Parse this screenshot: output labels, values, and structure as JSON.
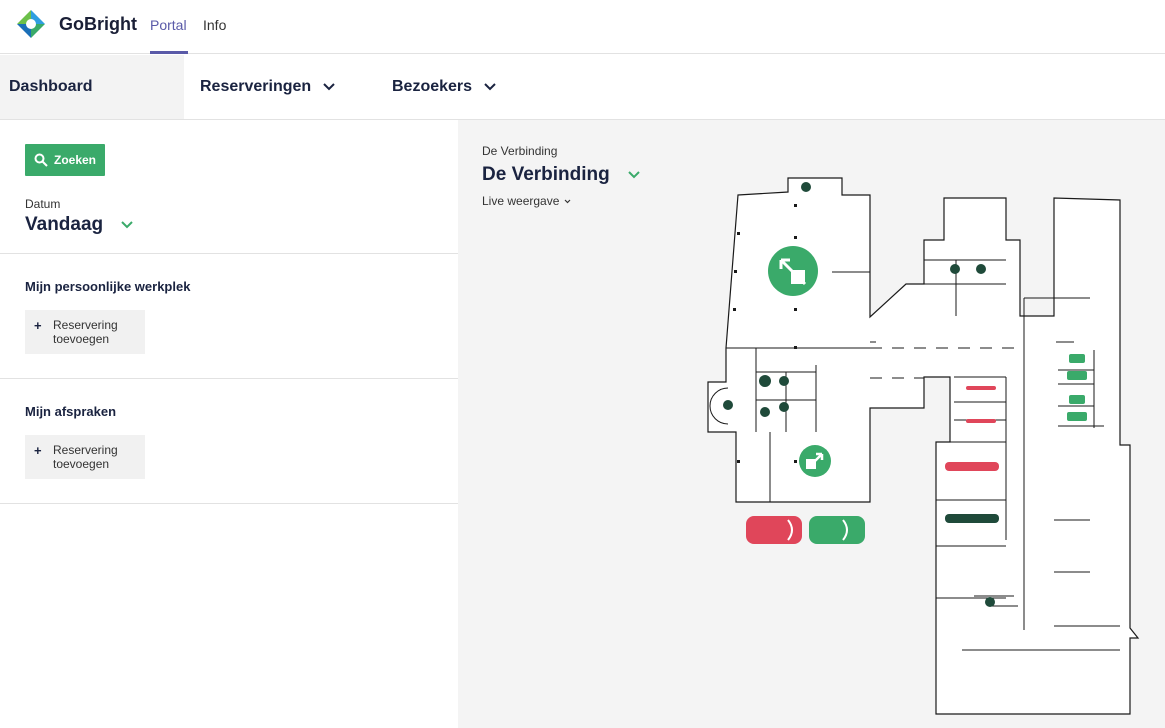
{
  "app": {
    "brand": "GoBright",
    "tabs": [
      {
        "label": "Portal",
        "active": true
      },
      {
        "label": "Info",
        "active": false
      }
    ]
  },
  "nav": {
    "dashboard": "Dashboard",
    "reservations": "Reserveringen",
    "visitors": "Bezoekers"
  },
  "sidebar": {
    "search_label": "Zoeken",
    "date_label": "Datum",
    "date_value": "Vandaag",
    "workspace_title": "Mijn persoonlijke werkplek",
    "workspace_add": "Reservering toevoegen",
    "appointments_title": "Mijn afspraken",
    "appointments_add": "Reservering toevoegen"
  },
  "map": {
    "location_label": "De Verbinding",
    "location_value": "De Verbinding",
    "view_mode": "Live weergave",
    "colors": {
      "available": "#3aaa6a",
      "occupied": "#e0465a",
      "reserved": "#1f4a3a"
    }
  }
}
